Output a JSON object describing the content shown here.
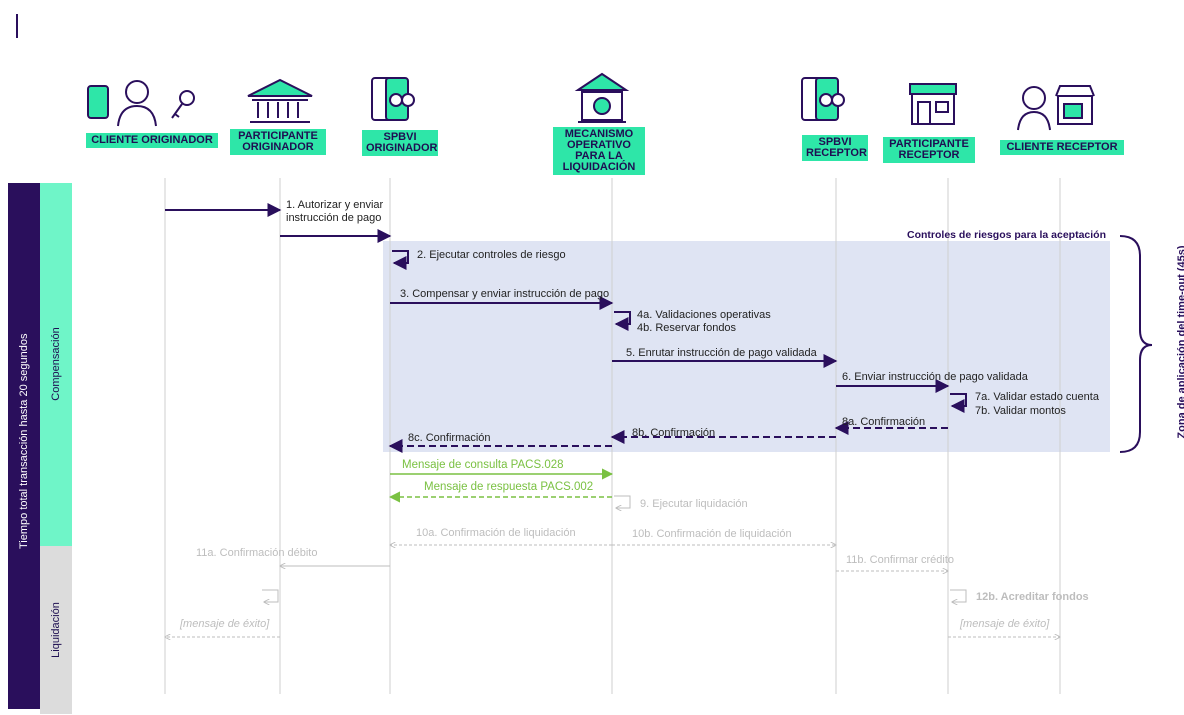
{
  "actors": [
    {
      "id": "cliente_originador",
      "label": "CLIENTE ORIGINADOR",
      "icon": "person-phone-key-icon"
    },
    {
      "id": "participante_originador",
      "label": "PARTICIPANTE ORIGINADOR",
      "icon": "bank-building-icon"
    },
    {
      "id": "spbvi_originador",
      "label": "SPBVI ORIGINADOR",
      "icon": "phones-transfer-icon"
    },
    {
      "id": "mecanismo",
      "label": "MECANISMO OPERATIVO PARA LA LIQUIDACIÓN",
      "icon": "central-bank-icon"
    },
    {
      "id": "spbvi_receptor",
      "label": "SPBVI RECEPTOR",
      "icon": "phones-transfer-icon"
    },
    {
      "id": "participante_receptor",
      "label": "PARTICIPANTE RECEPTOR",
      "icon": "shop-building-icon"
    },
    {
      "id": "cliente_receptor",
      "label": "CLIENTE RECEPTOR",
      "icon": "person-store-icon"
    }
  ],
  "side": {
    "total": "Tiempo total transacción hasta 20 segundos",
    "compensacion": "Compensación",
    "liquidacion": "Liquidación",
    "zona": "Zona de aplicación del time-out (45s)",
    "controles": "Controles de riesgos para la aceptación"
  },
  "messages": {
    "m1": "1. Autorizar y enviar instrucción de pago",
    "m2": "2. Ejecutar controles de riesgo",
    "m3": "3. Compensar y enviar instrucción de pago",
    "m4a": "4a. Validaciones operativas",
    "m4b": "4b. Reservar fondos",
    "m5": "5. Enrutar instrucción de pago validada",
    "m6": "6. Enviar instrucción de pago validada",
    "m7a": "7a. Validar estado cuenta",
    "m7b": "7b. Validar montos",
    "m8a": "8a. Confirmación",
    "m8b": "8b. Confirmación",
    "m8c": "8c. Confirmación",
    "consulta": "Mensaje de consulta PACS.028",
    "respuesta": "Mensaje de respuesta PACS.002",
    "m9": "9. Ejecutar liquidación",
    "m10a": "10a. Confirmación de liquidación",
    "m10b": "10b. Confirmación de liquidación",
    "m11a": "11a. Confirmación débito",
    "m11b": "11b. Confirmar crédito",
    "m12b": "12b. Acreditar fondos",
    "exito1": "[mensaje de éxito]",
    "exito2": "[mensaje de éxito]"
  },
  "colors": {
    "navy": "#2a0f5c",
    "green": "#2ee6a8",
    "lightgreen": "#6ff5c8",
    "lavender": "#dfe4f3",
    "consulta": "#7ac142",
    "gray": "#bdbdbd"
  }
}
